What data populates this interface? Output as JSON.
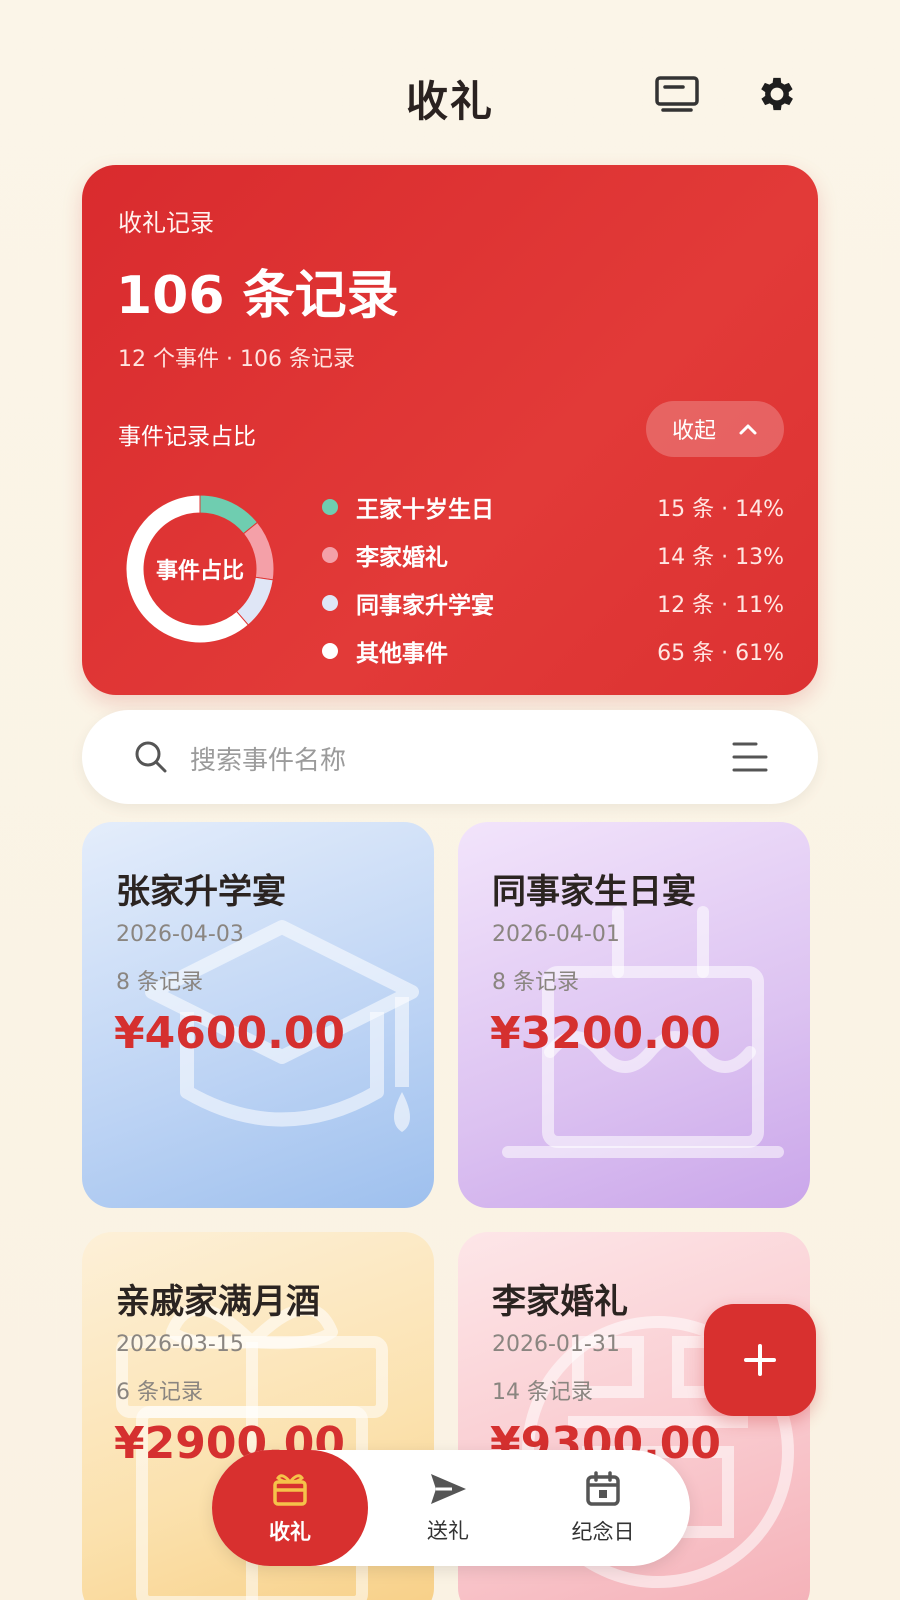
{
  "header": {
    "title": "收礼"
  },
  "summary": {
    "label": "收礼记录",
    "big": "106 条记录",
    "sub": "12 个事件 · 106 条记录",
    "share_label": "事件记录占比",
    "collapse_label": "收起",
    "donut_center": "事件占比"
  },
  "chart_data": {
    "type": "pie",
    "series": [
      {
        "name": "王家十岁生日",
        "stat": "15 条 · 14%",
        "count": 15,
        "percent": 14,
        "color": "#6fcdb0"
      },
      {
        "name": "李家婚礼",
        "stat": "14 条 · 13%",
        "count": 14,
        "percent": 13,
        "color": "#f4a0a8"
      },
      {
        "name": "同事家升学宴",
        "stat": "12 条 · 11%",
        "count": 12,
        "percent": 11,
        "color": "#dfe6f6"
      },
      {
        "name": "其他事件",
        "stat": "65 条 · 61%",
        "count": 65,
        "percent": 61,
        "color": "#ffffff"
      }
    ]
  },
  "search": {
    "placeholder": "搜索事件名称"
  },
  "events": [
    {
      "name": "张家升学宴",
      "date": "2026-04-03",
      "count": "8 条记录",
      "amount": "¥4600.00",
      "art": "graduation-cap-icon"
    },
    {
      "name": "同事家生日宴",
      "date": "2026-04-01",
      "count": "8 条记录",
      "amount": "¥3200.00",
      "art": "birthday-cake-icon"
    },
    {
      "name": "亲戚家满月酒",
      "date": "2026-03-15",
      "count": "6 条记录",
      "amount": "¥2900.00",
      "art": "gift-box-icon"
    },
    {
      "name": "李家婚礼",
      "date": "2026-01-31",
      "count": "14 条记录",
      "amount": "¥9300.00",
      "art": "double-happiness-icon"
    }
  ],
  "tabs": [
    {
      "label": "收礼",
      "icon": "gift-icon"
    },
    {
      "label": "送礼",
      "icon": "send-icon"
    },
    {
      "label": "纪念日",
      "icon": "calendar-icon"
    }
  ],
  "colors": {
    "primary": "#d8302f",
    "background": "#fbf5e8"
  }
}
